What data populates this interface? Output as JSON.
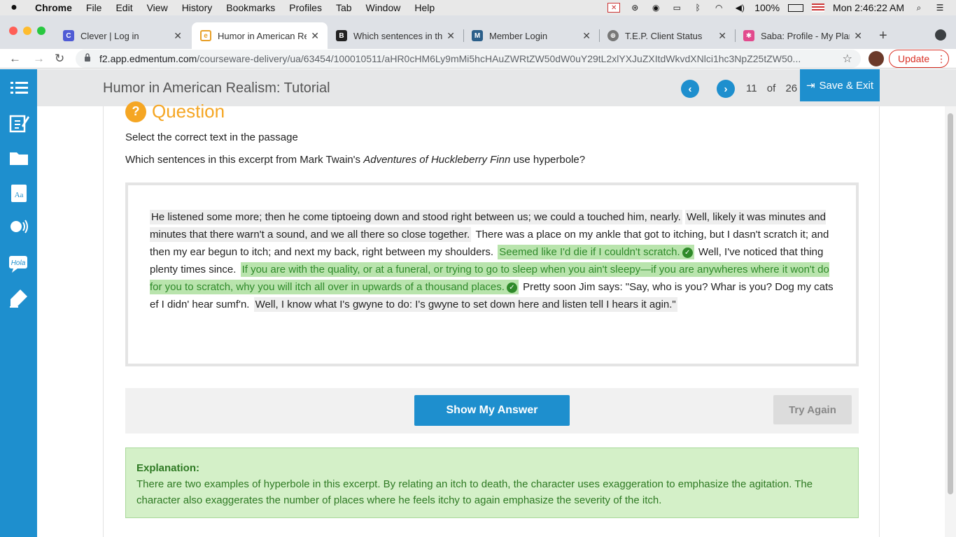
{
  "menubar": {
    "app_name": "Chrome",
    "items": [
      "File",
      "Edit",
      "View",
      "History",
      "Bookmarks",
      "Profiles",
      "Tab",
      "Window",
      "Help"
    ],
    "battery": "100%",
    "clock": "Mon 2:46:22 AM"
  },
  "tabs": [
    {
      "title": "Clever | Log in",
      "favicon": "clever-icon",
      "color": "#4f5bd5",
      "letter": "C"
    },
    {
      "title": "Humor in American Re",
      "favicon": "edmentum-icon",
      "color": "#e8a028",
      "letter": "e"
    },
    {
      "title": "Which sentences in thi",
      "favicon": "brainly-icon",
      "color": "#222222",
      "letter": "B"
    },
    {
      "title": "Member Login",
      "favicon": "member-icon",
      "color": "#2b5f8a",
      "letter": "M"
    },
    {
      "title": "T.E.P. Client Status",
      "favicon": "globe-icon",
      "color": "#777777",
      "letter": "⊕"
    },
    {
      "title": "Saba: Profile - My Plan",
      "favicon": "saba-icon",
      "color": "#e24a8d",
      "letter": "✱"
    }
  ],
  "address": {
    "domain": "f2.app.edmentum.com",
    "path": "/courseware-delivery/ua/63454/100010511/aHR0cHM6Ly9mMi5hcHAuZWRtZW50dW0uY29tL2xlYXJuZXItdWkvdXNlci1hc3NpZ25tZW50..."
  },
  "update_label": "Update",
  "header": {
    "title": "Humor in American Realism: Tutorial",
    "page_current": "11",
    "page_of": "of",
    "page_total": "26",
    "save_exit": "Save & Exit"
  },
  "question": {
    "heading": "Question",
    "instruction": "Select the correct text in the passage",
    "prompt_pre": "Which sentences in this excerpt from Mark Twain's ",
    "prompt_title": "Adventures of Huckleberry Finn",
    "prompt_post": " use hyperbole?",
    "sentences": [
      "He listened some more; then he come tiptoeing down and stood right between us; we could a touched him, nearly.",
      "Well, likely it was minutes and minutes that there warn't a sound, and we all there so close together.",
      "There was a place on my ankle that got to itching, but I dasn't scratch it; and then my ear begun to itch; and next my back, right between my shoulders.",
      "Seemed like I'd die if I couldn't scratch.",
      "Well, I've noticed that thing plenty times since.",
      "If you are with the quality, or at a funeral, or trying to go to sleep when you ain't sleepy—if you are anywheres where it won't do for you to scratch, why you will itch all over in upwards of a thousand places.",
      "Pretty soon Jim says: \"Say, who is you? Whar is you? Dog my cats ef I didn' hear sumf'n.",
      "Well, I know what I's gwyne to do: I's gwyne to set down here and listen tell I hears it agin.\""
    ]
  },
  "buttons": {
    "show_answer": "Show My Answer",
    "try_again": "Try Again"
  },
  "explanation": {
    "label": "Explanation:",
    "text": "There are two examples of hyperbole in this excerpt. By relating an itch to death, the character uses exaggeration to emphasize the agitation. The character also exaggerates the number of places where he feels itchy to again emphasize the severity of the itch."
  },
  "colors": {
    "brand_blue": "#1e8fce",
    "question_orange": "#f5a623",
    "correct_green": "#2f8a2a",
    "correct_bg": "#b9e4ad"
  }
}
